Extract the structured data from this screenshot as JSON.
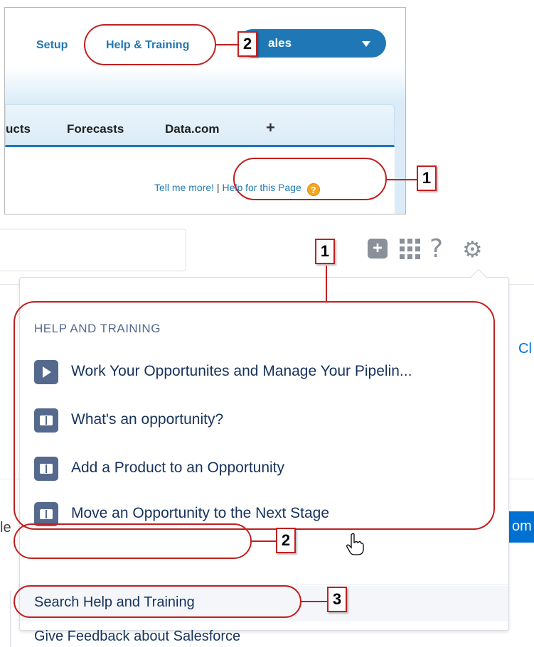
{
  "classic": {
    "setup_link": "Setup",
    "help_training_link": "Help & Training",
    "app_menu_label": "ales",
    "tabs": [
      "ucts",
      "Forecasts",
      "Data.com"
    ],
    "add_tab": "+",
    "tell_me_more": "Tell me more!",
    "separator": "|",
    "help_for_page": "Help for this Page",
    "help_icon_glyph": "?"
  },
  "lightning": {
    "global_actions_glyph": "+",
    "help_glyph": "?",
    "setup_glyph": "⚙",
    "background": {
      "cl_fragment": "Cl",
      "le_fragment": "le",
      "om_fragment": "om"
    },
    "dropdown": {
      "heading": "HELP AND TRAINING",
      "items": [
        {
          "icon": "video-play-icon",
          "label": "Work Your Opportunites and Manage Your Pipelin..."
        },
        {
          "icon": "book-icon",
          "label": "What's an opportunity?"
        },
        {
          "icon": "book-icon",
          "label": "Add a Product to an Opportunity"
        },
        {
          "icon": "book-icon",
          "label": "Move an Opportunity to the Next Stage"
        }
      ],
      "search_help": "Search Help and Training",
      "give_feedback": "Give Feedback about Salesforce"
    }
  },
  "callouts": {
    "top_1": "1",
    "top_2": "2",
    "bottom_1": "1",
    "bottom_2": "2",
    "bottom_3": "3"
  },
  "colors": {
    "annotation_red": "#c0201f",
    "classic_blue": "#1f78b5",
    "lightning_icon_tile": "#54698d",
    "lightning_text": "#16325c"
  }
}
